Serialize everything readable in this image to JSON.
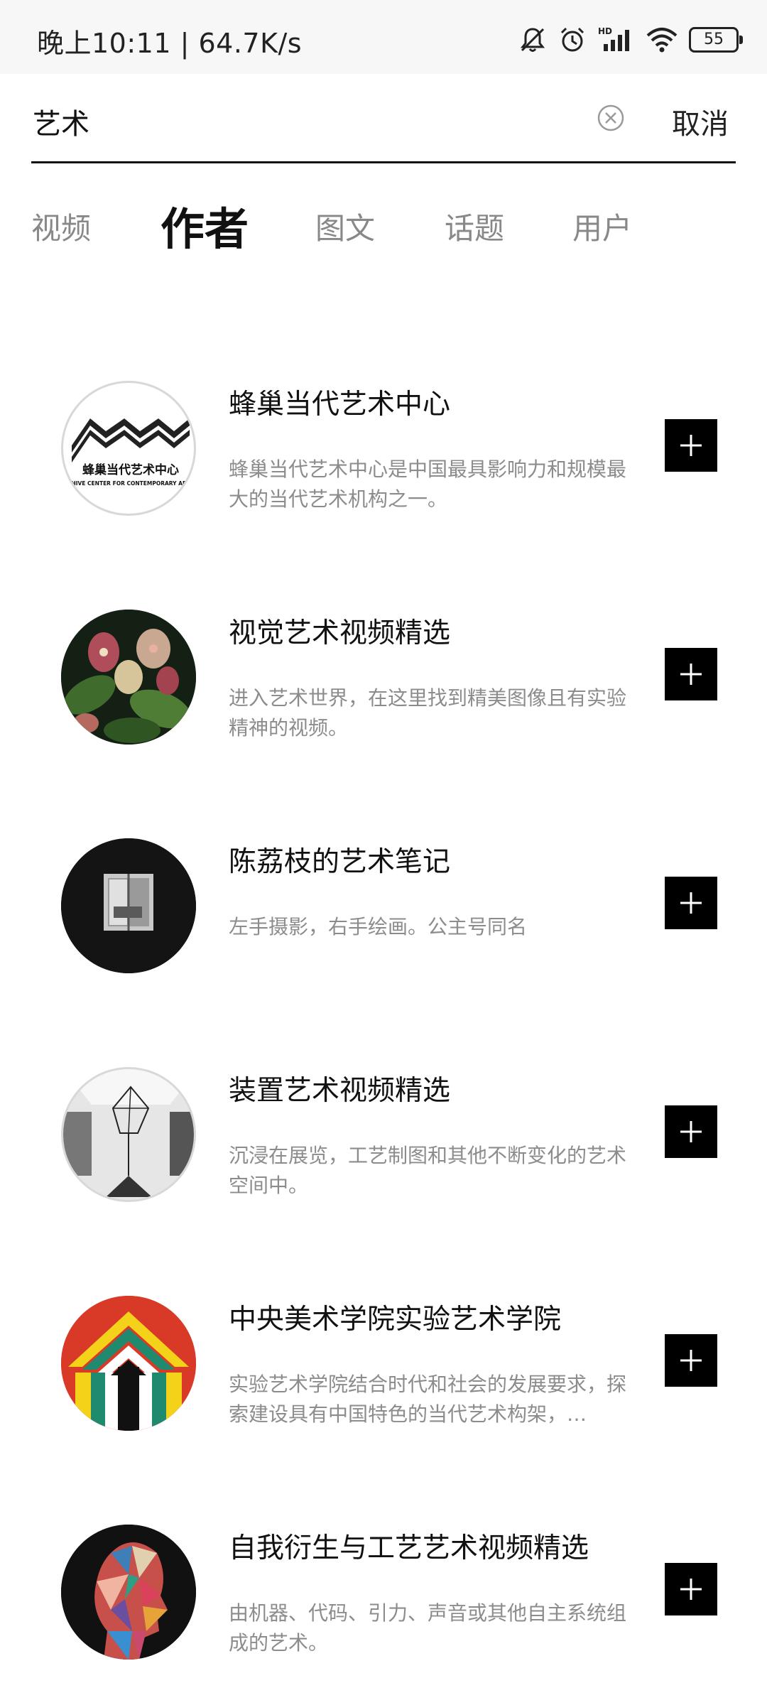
{
  "status_bar": {
    "time_speed": "晚上10:11 | 64.7K/s",
    "battery": "55",
    "icons": [
      "mute-bell-icon",
      "alarm-icon",
      "hd-signal-icon",
      "wifi-icon",
      "battery-icon"
    ]
  },
  "search": {
    "query": "艺术",
    "cancel_label": "取消"
  },
  "tabs": [
    {
      "label": "视频",
      "active": false
    },
    {
      "label": "作者",
      "active": true
    },
    {
      "label": "图文",
      "active": false
    },
    {
      "label": "话题",
      "active": false
    },
    {
      "label": "用户",
      "active": false
    }
  ],
  "authors": [
    {
      "title": "蜂巢当代艺术中心",
      "desc": "蜂巢当代艺术中心是中国最具影响力和规模最大的当代艺术机构之一。",
      "avatar_caption_cn": "蜂巢当代艺术中心",
      "avatar_caption_en": "HIVE CENTER FOR CONTEMPORARY ART"
    },
    {
      "title": "视觉艺术视频精选",
      "desc": "进入艺术世界，在这里找到精美图像且有实验精神的视频。"
    },
    {
      "title": "陈荔枝的艺术笔记",
      "desc": "左手摄影，右手绘画。公主号同名"
    },
    {
      "title": "装置艺术视频精选",
      "desc": "沉浸在展览，工艺制图和其他不断变化的艺术空间中。"
    },
    {
      "title": "中央美术学院实验艺术学院",
      "desc": "实验艺术学院结合时代和社会的发展要求，探索建设具有中国特色的当代艺术构架，…"
    },
    {
      "title": "自我衍生与工艺艺术视频精选",
      "desc": "由机器、代码、引力、声音或其他自主系统组成的艺术。"
    }
  ]
}
